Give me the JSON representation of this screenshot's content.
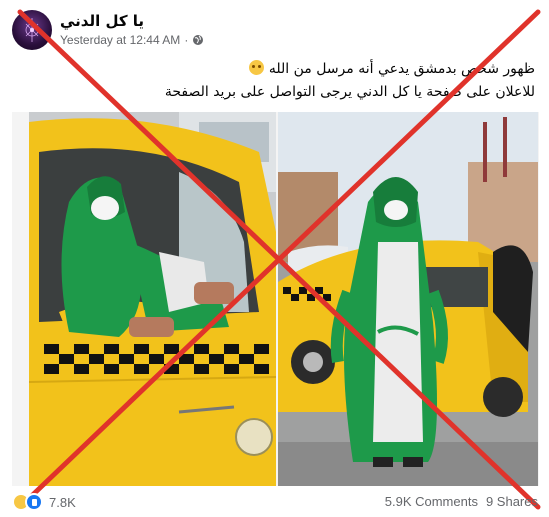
{
  "post": {
    "page_name": "يا كل الدني",
    "timestamp": "Yesterday at 12:44 AM",
    "separator": "·",
    "caption_line1": "ظهور شخص بدمشق يدعي أنه مرسل من الله",
    "caption_line2": "للاعلان على صفحة يا كل الدني يرجى التواصل على بريد الصفحة",
    "emoji": "flushed-face-emoji"
  },
  "photos": {
    "left": "man-in-taxi-photo",
    "right": "man-standing-by-taxi-photo"
  },
  "overlay": {
    "mark": "red-x",
    "color": "#e0332b"
  },
  "engagement": {
    "reactions_count": "7.8K",
    "comments": "5.9K Comments",
    "shares": "9 Shares"
  },
  "colors": {
    "taxi_yellow": "#f2c21b",
    "robe_green": "#1e9a4a",
    "secondary_text": "#65676b"
  }
}
